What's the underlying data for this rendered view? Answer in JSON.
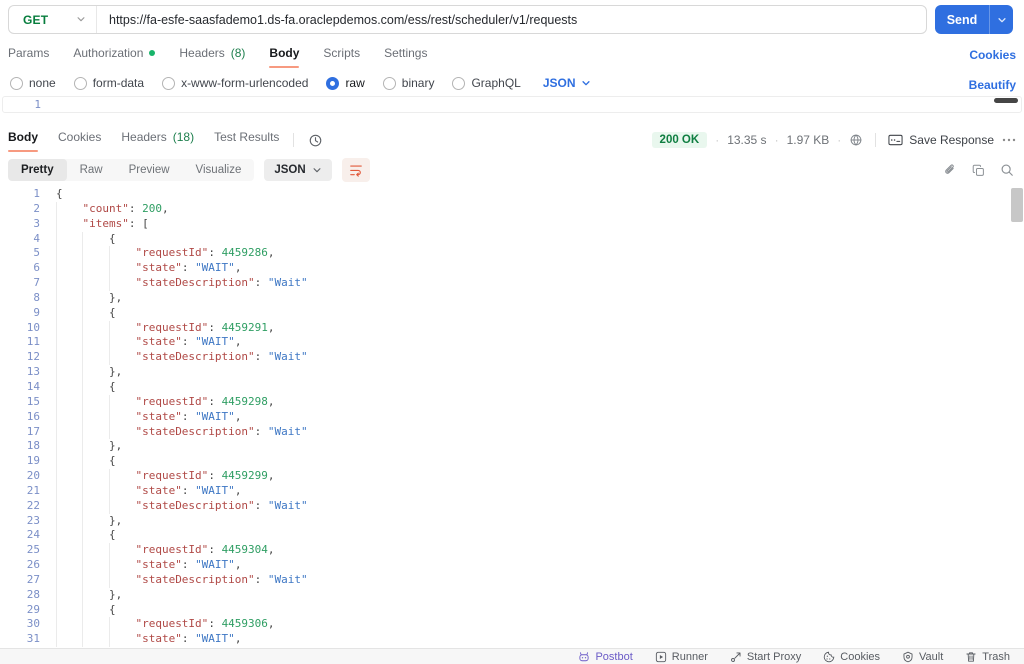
{
  "request": {
    "method": "GET",
    "url": "https://fa-esfe-saasfademo1.ds-fa.oraclepdemos.com/ess/rest/scheduler/v1/requests",
    "send_label": "Send",
    "cookies_link": "Cookies",
    "tabs": [
      {
        "label": "Params"
      },
      {
        "label": "Authorization",
        "dot": true
      },
      {
        "label": "Headers",
        "count": "(8)"
      },
      {
        "label": "Body",
        "active": true
      },
      {
        "label": "Scripts"
      },
      {
        "label": "Settings"
      }
    ],
    "body_modes": [
      {
        "label": "none"
      },
      {
        "label": "form-data"
      },
      {
        "label": "x-www-form-urlencoded"
      },
      {
        "label": "raw",
        "selected": true
      },
      {
        "label": "binary"
      },
      {
        "label": "GraphQL"
      }
    ],
    "raw_language": "JSON",
    "beautify_link": "Beautify",
    "editor_line_number": "1"
  },
  "response": {
    "tabs": [
      {
        "label": "Body",
        "active": true
      },
      {
        "label": "Cookies"
      },
      {
        "label": "Headers",
        "count": "(18)"
      },
      {
        "label": "Test Results"
      }
    ],
    "history_icon": "history-clock-icon",
    "status": "200 OK",
    "time": "13.35 s",
    "size": "1.97 KB",
    "network_icon": "globe-lock-icon",
    "save_label": "Save Response",
    "more_icon": "more-options-icon",
    "views": [
      {
        "label": "Pretty",
        "active": true
      },
      {
        "label": "Raw"
      },
      {
        "label": "Preview"
      },
      {
        "label": "Visualize"
      }
    ],
    "view_language": "JSON",
    "toolbar_icons": [
      "wrap-text",
      "link",
      "copy",
      "search"
    ],
    "body_lines": [
      {
        "n": "1",
        "indent": 0,
        "tokens": [
          [
            "p",
            "{"
          ]
        ]
      },
      {
        "n": "2",
        "indent": 1,
        "tokens": [
          [
            "k",
            "\"count\""
          ],
          [
            "p",
            ": "
          ],
          [
            "n",
            "200"
          ],
          [
            "p",
            ","
          ]
        ]
      },
      {
        "n": "3",
        "indent": 1,
        "tokens": [
          [
            "k",
            "\"items\""
          ],
          [
            "p",
            ": ["
          ]
        ]
      },
      {
        "n": "4",
        "indent": 2,
        "tokens": [
          [
            "p",
            "{"
          ]
        ]
      },
      {
        "n": "5",
        "indent": 3,
        "tokens": [
          [
            "k",
            "\"requestId\""
          ],
          [
            "p",
            ": "
          ],
          [
            "n",
            "4459286"
          ],
          [
            "p",
            ","
          ]
        ]
      },
      {
        "n": "6",
        "indent": 3,
        "tokens": [
          [
            "k",
            "\"state\""
          ],
          [
            "p",
            ": "
          ],
          [
            "s",
            "\"WAIT\""
          ],
          [
            "p",
            ","
          ]
        ]
      },
      {
        "n": "7",
        "indent": 3,
        "tokens": [
          [
            "k",
            "\"stateDescription\""
          ],
          [
            "p",
            ": "
          ],
          [
            "s",
            "\"Wait\""
          ]
        ]
      },
      {
        "n": "8",
        "indent": 2,
        "tokens": [
          [
            "p",
            "},"
          ]
        ]
      },
      {
        "n": "9",
        "indent": 2,
        "tokens": [
          [
            "p",
            "{"
          ]
        ]
      },
      {
        "n": "10",
        "indent": 3,
        "tokens": [
          [
            "k",
            "\"requestId\""
          ],
          [
            "p",
            ": "
          ],
          [
            "n",
            "4459291"
          ],
          [
            "p",
            ","
          ]
        ]
      },
      {
        "n": "11",
        "indent": 3,
        "tokens": [
          [
            "k",
            "\"state\""
          ],
          [
            "p",
            ": "
          ],
          [
            "s",
            "\"WAIT\""
          ],
          [
            "p",
            ","
          ]
        ]
      },
      {
        "n": "12",
        "indent": 3,
        "tokens": [
          [
            "k",
            "\"stateDescription\""
          ],
          [
            "p",
            ": "
          ],
          [
            "s",
            "\"Wait\""
          ]
        ]
      },
      {
        "n": "13",
        "indent": 2,
        "tokens": [
          [
            "p",
            "},"
          ]
        ]
      },
      {
        "n": "14",
        "indent": 2,
        "tokens": [
          [
            "p",
            "{"
          ]
        ]
      },
      {
        "n": "15",
        "indent": 3,
        "tokens": [
          [
            "k",
            "\"requestId\""
          ],
          [
            "p",
            ": "
          ],
          [
            "n",
            "4459298"
          ],
          [
            "p",
            ","
          ]
        ]
      },
      {
        "n": "16",
        "indent": 3,
        "tokens": [
          [
            "k",
            "\"state\""
          ],
          [
            "p",
            ": "
          ],
          [
            "s",
            "\"WAIT\""
          ],
          [
            "p",
            ","
          ]
        ]
      },
      {
        "n": "17",
        "indent": 3,
        "tokens": [
          [
            "k",
            "\"stateDescription\""
          ],
          [
            "p",
            ": "
          ],
          [
            "s",
            "\"Wait\""
          ]
        ]
      },
      {
        "n": "18",
        "indent": 2,
        "tokens": [
          [
            "p",
            "},"
          ]
        ]
      },
      {
        "n": "19",
        "indent": 2,
        "tokens": [
          [
            "p",
            "{"
          ]
        ]
      },
      {
        "n": "20",
        "indent": 3,
        "tokens": [
          [
            "k",
            "\"requestId\""
          ],
          [
            "p",
            ": "
          ],
          [
            "n",
            "4459299"
          ],
          [
            "p",
            ","
          ]
        ]
      },
      {
        "n": "21",
        "indent": 3,
        "tokens": [
          [
            "k",
            "\"state\""
          ],
          [
            "p",
            ": "
          ],
          [
            "s",
            "\"WAIT\""
          ],
          [
            "p",
            ","
          ]
        ]
      },
      {
        "n": "22",
        "indent": 3,
        "tokens": [
          [
            "k",
            "\"stateDescription\""
          ],
          [
            "p",
            ": "
          ],
          [
            "s",
            "\"Wait\""
          ]
        ]
      },
      {
        "n": "23",
        "indent": 2,
        "tokens": [
          [
            "p",
            "},"
          ]
        ]
      },
      {
        "n": "24",
        "indent": 2,
        "tokens": [
          [
            "p",
            "{"
          ]
        ]
      },
      {
        "n": "25",
        "indent": 3,
        "tokens": [
          [
            "k",
            "\"requestId\""
          ],
          [
            "p",
            ": "
          ],
          [
            "n",
            "4459304"
          ],
          [
            "p",
            ","
          ]
        ]
      },
      {
        "n": "26",
        "indent": 3,
        "tokens": [
          [
            "k",
            "\"state\""
          ],
          [
            "p",
            ": "
          ],
          [
            "s",
            "\"WAIT\""
          ],
          [
            "p",
            ","
          ]
        ]
      },
      {
        "n": "27",
        "indent": 3,
        "tokens": [
          [
            "k",
            "\"stateDescription\""
          ],
          [
            "p",
            ": "
          ],
          [
            "s",
            "\"Wait\""
          ]
        ]
      },
      {
        "n": "28",
        "indent": 2,
        "tokens": [
          [
            "p",
            "},"
          ]
        ]
      },
      {
        "n": "29",
        "indent": 2,
        "tokens": [
          [
            "p",
            "{"
          ]
        ]
      },
      {
        "n": "30",
        "indent": 3,
        "tokens": [
          [
            "k",
            "\"requestId\""
          ],
          [
            "p",
            ": "
          ],
          [
            "n",
            "4459306"
          ],
          [
            "p",
            ","
          ]
        ]
      },
      {
        "n": "31",
        "indent": 3,
        "tokens": [
          [
            "k",
            "\"state\""
          ],
          [
            "p",
            ": "
          ],
          [
            "s",
            "\"WAIT\""
          ],
          [
            "p",
            ","
          ]
        ]
      }
    ]
  },
  "status_bar": {
    "items": [
      {
        "label": "Postbot",
        "icon": "postbot",
        "accent": true
      },
      {
        "label": "Runner",
        "icon": "runner"
      },
      {
        "label": "Start Proxy",
        "icon": "start-proxy"
      },
      {
        "label": "Cookies",
        "icon": "cookie"
      },
      {
        "label": "Vault",
        "icon": "vault"
      },
      {
        "label": "Trash",
        "icon": "trash"
      }
    ]
  },
  "colors": {
    "accent_blue": "#2f6fe0",
    "method_green": "#077d3d",
    "success_green": "#0f7e41",
    "tab_underline_orange": "#f79a80",
    "json_key_red": "#b04946",
    "json_string_blue": "#3e77c4",
    "json_number_green": "#2f9e63",
    "line_number_blue": "#7b8fc7",
    "postbot_purple": "#6b5bc7"
  }
}
